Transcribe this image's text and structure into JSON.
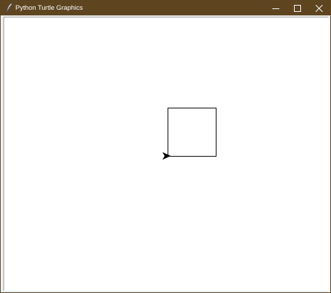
{
  "window": {
    "title": "Python Turtle Graphics",
    "title_bar_color": "#5e4520",
    "buttons": {
      "minimize_icon": "minimize-icon",
      "maximize_icon": "maximize-icon",
      "close_icon": "close-icon"
    }
  },
  "canvas": {
    "background": "#ffffff",
    "shapes": [
      {
        "type": "square",
        "stroke": "#000000"
      }
    ],
    "turtle": {
      "shape": "arrow",
      "heading": "east",
      "color": "#000000"
    }
  }
}
